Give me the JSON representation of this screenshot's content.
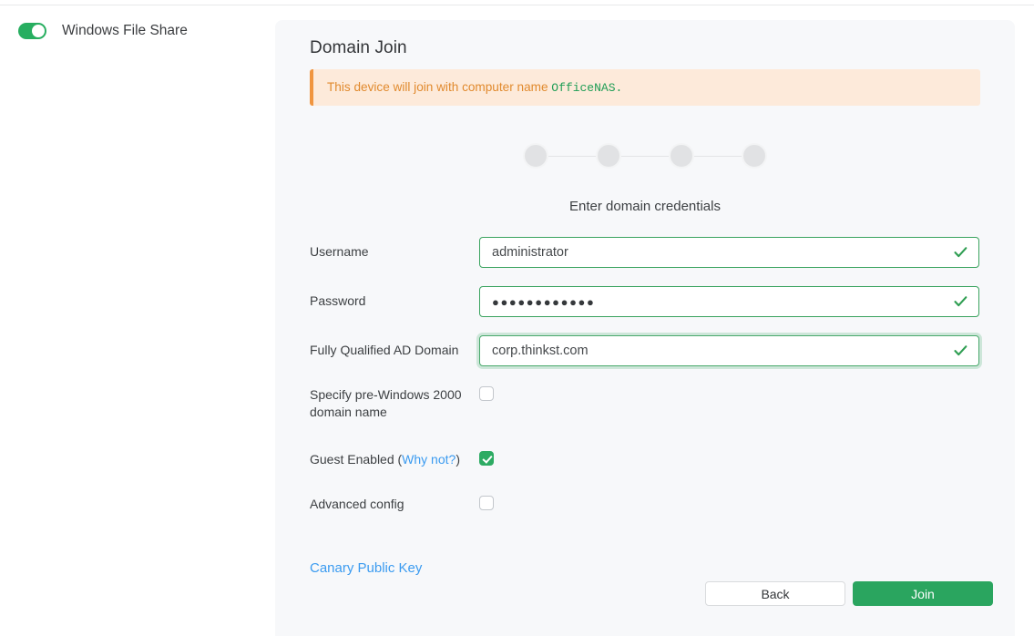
{
  "left": {
    "toggle_state": "on",
    "toggle_icon": "toggle-on-icon",
    "label": "Windows File Share"
  },
  "panel": {
    "title": "Domain Join",
    "alert": {
      "icon": "warning-bar-icon",
      "text_prefix": "This device will join with computer name ",
      "computer_name": "OfficeNAS.",
      "accent_color": "#f0953f",
      "background_color": "#fdeada",
      "text_color": "#e18a2e",
      "name_color": "#1f9d55"
    },
    "stepper": {
      "steps": 4,
      "current": 0,
      "dot_color": "#e1e2e4"
    },
    "section_heading": "Enter domain credentials",
    "fields": [
      {
        "label": "Username",
        "value": "administrator",
        "placeholder": "",
        "valid": true,
        "focused": false,
        "icon": "check-icon"
      },
      {
        "label": "Password",
        "value": "●●●●●●●●●●●●",
        "placeholder": "",
        "valid": true,
        "focused": false,
        "icon": "check-icon"
      },
      {
        "label": "Fully Qualified AD Domain",
        "value": "corp.thinkst.com",
        "placeholder": "",
        "valid": true,
        "focused": true,
        "icon": "check-icon"
      }
    ],
    "checkboxes": [
      {
        "label": "Specify pre-Windows 2000 domain name",
        "checked": false
      },
      {
        "label_prefix": "Guest Enabled (",
        "link_text": "Why not?",
        "label_suffix": ")",
        "checked": true
      },
      {
        "label": "Advanced config",
        "checked": false
      }
    ],
    "canary_link": "Canary Public Key",
    "buttons": {
      "back": "Back",
      "join": "Join"
    },
    "accent_green": "#2aa55f",
    "link_blue": "#3b9bf0"
  }
}
